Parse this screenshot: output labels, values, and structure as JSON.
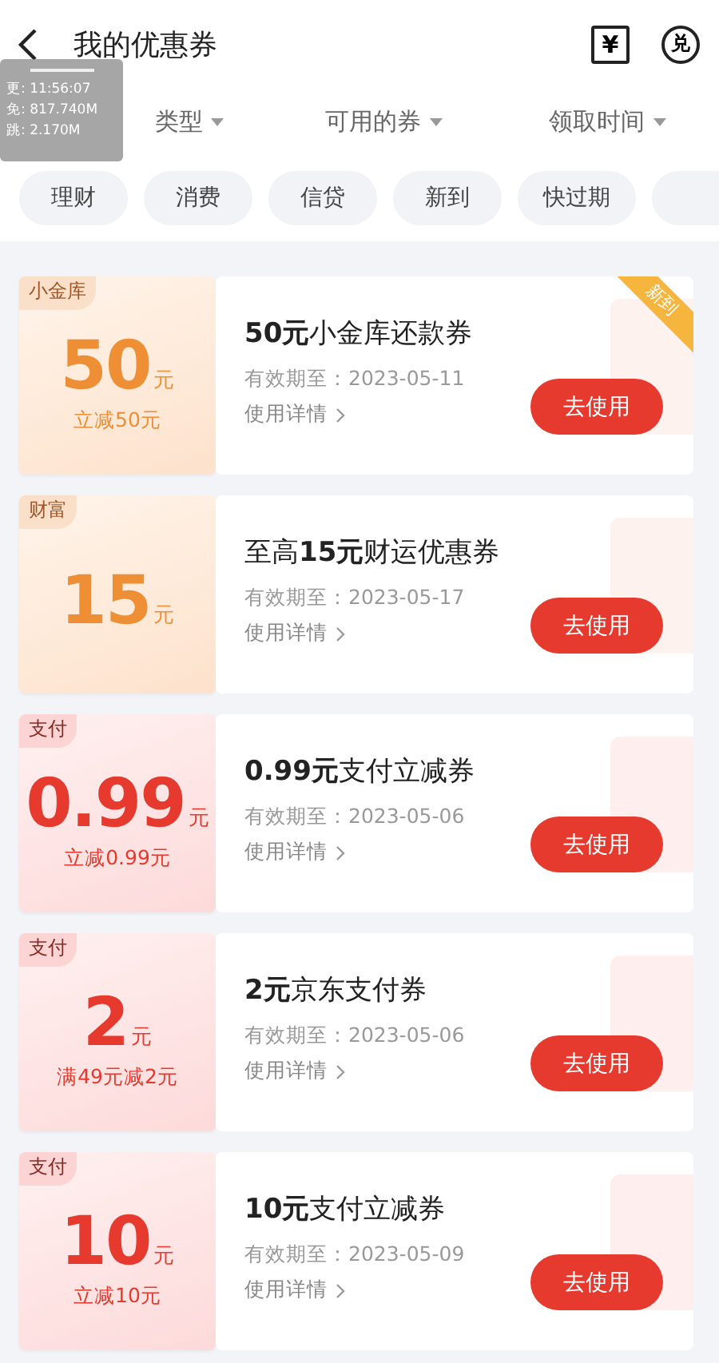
{
  "header": {
    "title": "我的优惠券",
    "icons": [
      "¥",
      "兑"
    ]
  },
  "debug_overlay": {
    "lines": [
      "更: 11:56:07",
      "免: 817.740M",
      "跳: 2.170M"
    ]
  },
  "filters": [
    {
      "label": "类型"
    },
    {
      "label": "可用的券"
    },
    {
      "label": "领取时间"
    }
  ],
  "chips": [
    {
      "label": "理财"
    },
    {
      "label": "消费"
    },
    {
      "label": "信贷"
    },
    {
      "label": "新到"
    },
    {
      "label": "快过期"
    }
  ],
  "coupons": [
    {
      "kind": "gold",
      "tag": "小金库",
      "amount": "50",
      "unit": "元",
      "subtitle": "立减50元",
      "title_bold": "50元",
      "title": "小金库还款券",
      "validity": "有效期至：2023-05-11",
      "details": "使用详情",
      "button": "去使用",
      "ribbon": "新到"
    },
    {
      "kind": "gold",
      "tag": "财富",
      "amount": "15",
      "unit": "元",
      "title_pre": "至高",
      "title_bold": "15元",
      "title": "财运优惠券",
      "validity": "有效期至：2023-05-17",
      "details": "使用详情",
      "button": "去使用"
    },
    {
      "kind": "pay",
      "tag": "支付",
      "amount": "0.99",
      "unit": "元",
      "subtitle": "立减0.99元",
      "title_bold": "0.99元",
      "title": "支付立减券",
      "validity": "有效期至：2023-05-06",
      "details": "使用详情",
      "button": "去使用"
    },
    {
      "kind": "pay",
      "tag": "支付",
      "amount": "2",
      "unit": "元",
      "subtitle": "满49元减2元",
      "title_bold": "2元",
      "title": "京东支付券",
      "validity": "有效期至：2023-05-06",
      "details": "使用详情",
      "button": "去使用"
    },
    {
      "kind": "pay",
      "tag": "支付",
      "amount": "10",
      "unit": "元",
      "subtitle": "立减10元",
      "title_bold": "10元",
      "title": "支付立减券",
      "validity": "有效期至：2023-05-09",
      "details": "使用详情",
      "button": "去使用"
    }
  ]
}
